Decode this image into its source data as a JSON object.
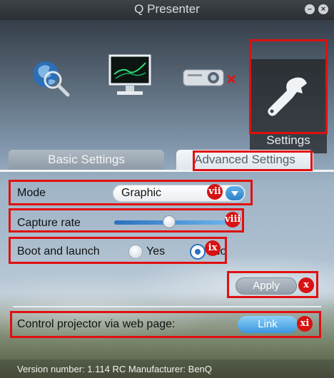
{
  "window": {
    "title": "Q Presenter"
  },
  "nav": {
    "items": [
      {
        "name": "web"
      },
      {
        "name": "display"
      },
      {
        "name": "projector"
      },
      {
        "name": "settings",
        "label": "Settings",
        "active": true
      }
    ]
  },
  "tabs": {
    "basic": "Basic Settings",
    "advanced": "Advanced Settings",
    "active": "advanced"
  },
  "settings": {
    "mode": {
      "label": "Mode",
      "value": "Graphic",
      "marker": "vii"
    },
    "capture_rate": {
      "label": "Capture rate",
      "level": 0.45,
      "marker": "viii"
    },
    "boot_launch": {
      "label": "Boot and launch",
      "yes_label": "Yes",
      "no_label": "No",
      "selected": "No",
      "marker": "ix"
    },
    "apply": {
      "label": "Apply",
      "marker": "x"
    },
    "web_control": {
      "label": "Control projector via web page:",
      "button": "Link",
      "marker": "xi"
    }
  },
  "footer": {
    "text": "Version number: 1.114 RC  Manufacturer: BenQ"
  },
  "colors": {
    "annotation": "#e01010",
    "accent": "#2a72bf"
  }
}
